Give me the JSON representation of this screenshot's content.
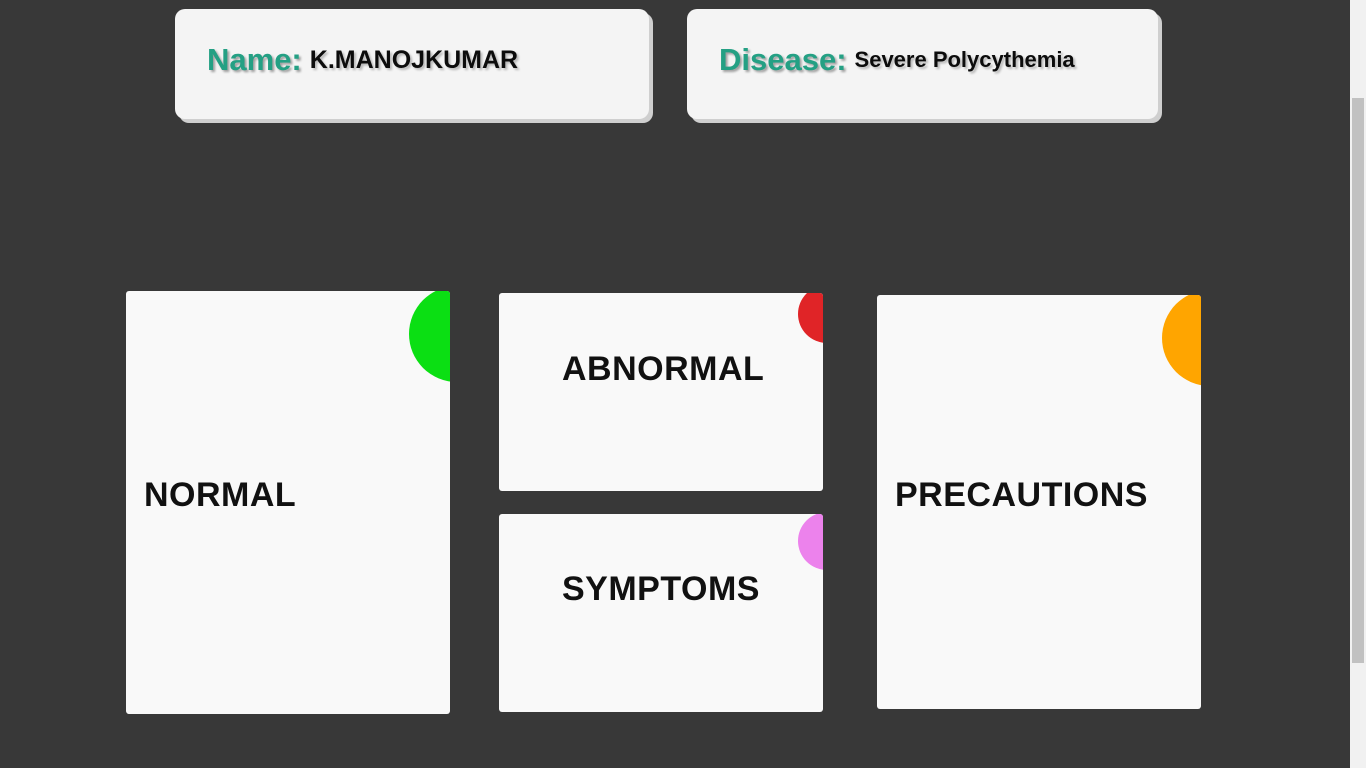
{
  "patient": {
    "name_label": "Name:",
    "name_value": "K.MANOJKUMAR",
    "disease_label": "Disease:",
    "disease_value": "Severe Polycythemia"
  },
  "cards": {
    "normal": {
      "title": "NORMAL",
      "accent": "#0bdf13"
    },
    "abnormal": {
      "title": "ABNORMAL",
      "accent": "#e02427"
    },
    "symptoms": {
      "title": "SYMPTOMS",
      "accent": "#ec82ec"
    },
    "precautions": {
      "title": "PRECAUTIONS",
      "accent": "#ffa500"
    }
  },
  "colors": {
    "background": "#383838",
    "card": "#f9f9f9",
    "label": "#24a084"
  }
}
